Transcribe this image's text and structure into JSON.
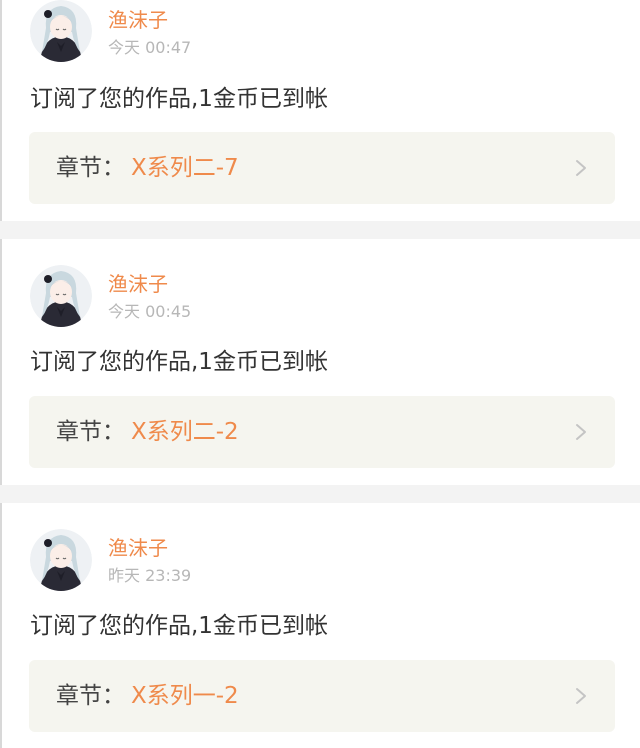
{
  "colors": {
    "accent": "#ef8a4b",
    "time_gray": "#b7b7b7",
    "card_bg": "#ffffff",
    "page_bg": "#f3f3f3",
    "chapter_bg": "#f5f5ef"
  },
  "notifications": [
    {
      "username": "渔沫子",
      "time": "今天 00:47",
      "message": "订阅了您的作品,1金币已到帐",
      "chapter_label": "章节：",
      "chapter_title": "X系列二-7",
      "avatar_icon": "anime-girl-avatar",
      "arrow_icon": "chevron-right-icon"
    },
    {
      "username": "渔沫子",
      "time": "今天 00:45",
      "message": "订阅了您的作品,1金币已到帐",
      "chapter_label": "章节：",
      "chapter_title": "X系列二-2",
      "avatar_icon": "anime-girl-avatar",
      "arrow_icon": "chevron-right-icon"
    },
    {
      "username": "渔沫子",
      "time": "昨天 23:39",
      "message": "订阅了您的作品,1金币已到帐",
      "chapter_label": "章节：",
      "chapter_title": "X系列一-2",
      "avatar_icon": "anime-girl-avatar",
      "arrow_icon": "chevron-right-icon"
    }
  ]
}
